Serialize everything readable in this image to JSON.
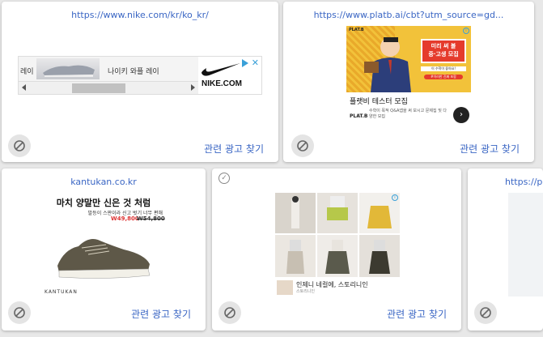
{
  "cards": [
    {
      "url": "https://www.nike.com/kr/ko_kr/",
      "find_label": "관련 광고 찾기"
    },
    {
      "url": "https://www.platb.ai/cbt?utm_source=gd...",
      "find_label": "관련 광고 찾기"
    },
    {
      "url": "kantukan.co.kr",
      "find_label": "관련 광고 찾기"
    },
    {
      "url": "",
      "find_label": "관련 광고 찾기"
    },
    {
      "url": "https://pl",
      "find_label": ""
    }
  ],
  "ads": {
    "nike": {
      "text_left": "레이",
      "text_mid": "나이키 와플 레이",
      "brand": "NIKE.COM"
    },
    "platb": {
      "logo": "PLAT.B",
      "badge_line1": "미리 써 볼",
      "badge_line2": "중·고생 모집",
      "badge_line3": "이 수학이 좋아요!",
      "badge_line4": "#이러한 진짜 포함",
      "title": "플랫비 테스터 모집",
      "footer_logo": "PLAT.B",
      "footer_text": "수학이 목적 Q&A앱을 써 보시고 문제집 및 다양한 모집"
    },
    "kantukan": {
      "headline": "마치 양말만 신은 것 처럼",
      "sub": "발등이 스판이라 신고 벗기 너무 편해",
      "price_new": "W49,800",
      "price_old": "W54,800",
      "brand": "KANTUKAN"
    },
    "clothes": {
      "caption": "인제니 네컬에, 스토리니인",
      "caption_sub": "스토리니인"
    }
  },
  "icons": {
    "block": "block-icon",
    "check": "check-circle-icon",
    "adchoices": "adchoices-icon",
    "close": "close-icon",
    "chevron": "chevron-right-icon"
  },
  "colors": {
    "link": "#3a66c4",
    "card_bg": "#ffffff",
    "page_bg": "#e8e8e8"
  }
}
